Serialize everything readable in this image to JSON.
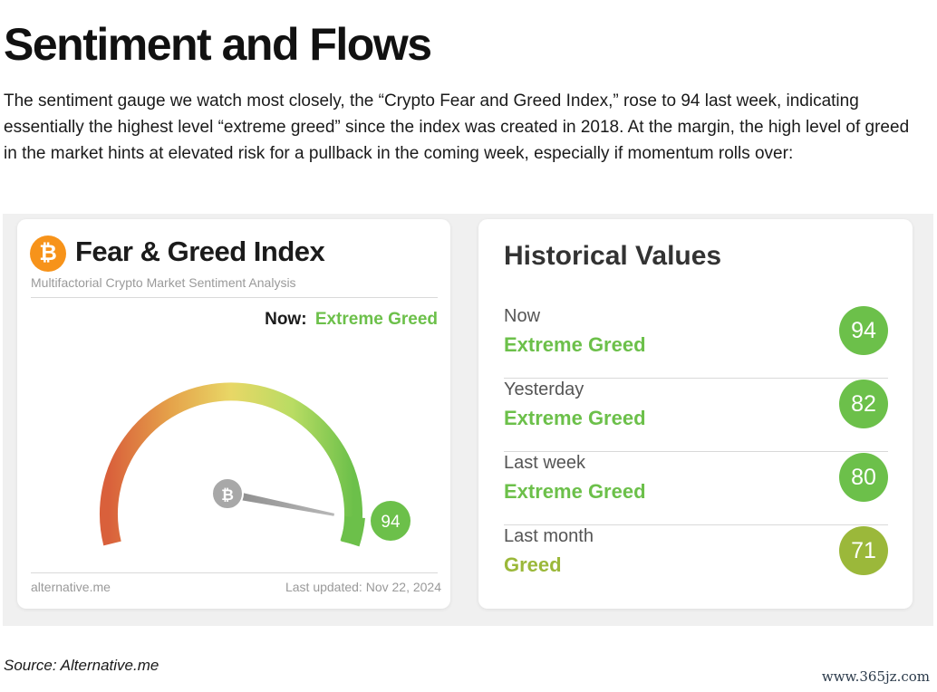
{
  "page": {
    "title": "Sentiment and Flows",
    "intro": "The sentiment gauge we watch most closely, the “Crypto Fear and Greed Index,” rose to 94 last week, indicating essentially the highest level “extreme greed” since the index was created in 2018. At the margin, the high level of greed in the market hints at elevated risk for a pullback in the coming week, especially if momentum rolls over:",
    "source": "Source: Alternative.me",
    "watermark": "www.365jz.com"
  },
  "gauge_card": {
    "icon": "bitcoin-icon",
    "btc_symbol": "₿",
    "title": "Fear & Greed Index",
    "subtitle": "Multifactorial Crypto Market Sentiment Analysis",
    "now_label": "Now:",
    "now_value": "Extreme Greed",
    "value": "94",
    "value_numeric": 94,
    "scale_max": 100,
    "footer_left": "alternative.me",
    "footer_right": "Last updated: Nov 22, 2024",
    "colors": {
      "value_green": "#6cc04a",
      "needle": "#9a9a9a",
      "btc_orange": "#f7931a"
    }
  },
  "historical": {
    "title": "Historical Values",
    "rows": [
      {
        "label": "Now",
        "classification": "Extreme Greed",
        "value": "94",
        "color": "#6cc04a"
      },
      {
        "label": "Yesterday",
        "classification": "Extreme Greed",
        "value": "82",
        "color": "#6cc04a"
      },
      {
        "label": "Last week",
        "classification": "Extreme Greed",
        "value": "80",
        "color": "#6cc04a"
      },
      {
        "label": "Last month",
        "classification": "Greed",
        "value": "71",
        "color": "#9bb83a"
      }
    ]
  }
}
